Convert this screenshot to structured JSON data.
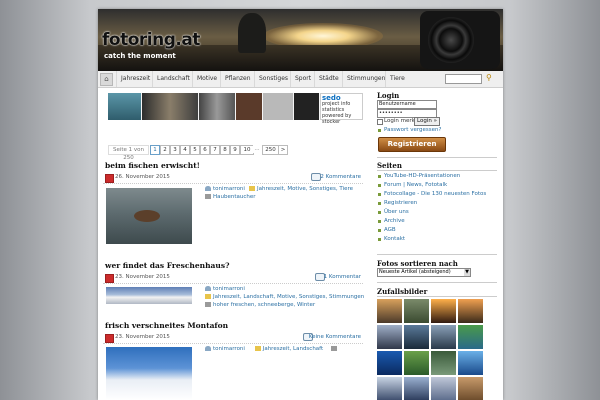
{
  "header": {
    "logo": "fotoring.at",
    "tagline": "catch the moment"
  },
  "nav": {
    "items": [
      "Jahreszeit",
      "Landschaft",
      "Motive",
      "Pflanzen",
      "Sonstiges",
      "Sport",
      "Städte",
      "Stimmungen",
      "Tiere"
    ]
  },
  "banner": {
    "sedo_title": "sedo",
    "sedo_line1": "project info",
    "sedo_line2": "statistics",
    "sedo_line3": "powered by stocker"
  },
  "pagination": {
    "info": "Seite 1 von 250",
    "pages": [
      "1",
      "2",
      "3",
      "4",
      "5",
      "6",
      "7",
      "8",
      "9",
      "10",
      "...",
      "250",
      ">"
    ]
  },
  "posts": [
    {
      "title": "beim fischen erwischt!",
      "date": "26. November 2015",
      "comments": "2 Kommentare",
      "author": "tonimarroni",
      "categories": "Jahreszeit, Motive, Sonstiges, Tiere",
      "tags": "Haubentaucher"
    },
    {
      "title": "wer findet das Freschenhaus?",
      "date": "23. November 2015",
      "comments": "1 Kommentar",
      "author": "tonimarroni",
      "categories": "Jahreszeit, Landschaft, Motive, Sonstiges, Stimmungen",
      "tags": "hoher freschen, schneeberge, Winter"
    },
    {
      "title": "frisch verschneites Montafon",
      "date": "23. November 2015",
      "comments": "Keine Kommentare",
      "author": "tonimarroni",
      "categories": "Jahreszeit, Landschaft",
      "tags": ""
    }
  ],
  "login": {
    "heading": "Login",
    "username_value": "Benutzername",
    "password_value": "••••••••",
    "remember_label": "Login merken",
    "login_button": "Login »",
    "forgot": "Passwort vergessen?",
    "register_button": "Registrieren"
  },
  "pages_widget": {
    "heading": "Seiten",
    "items": [
      "YouTube-HD-Präsentationen",
      "Forum | News, Fototalk",
      "Fotocollage - Die 130 neuesten Fotos",
      "Registrieren",
      "Über uns",
      "Archive",
      "AGB",
      "Kontakt"
    ]
  },
  "sort_widget": {
    "heading": "Fotos sortieren nach",
    "selected": "Neueste Artikel (absteigend)"
  },
  "random_widget": {
    "heading": "Zufallsbilder"
  },
  "colors": {
    "link": "#2a6fa3",
    "register_button": "#b46a25",
    "bullet": "#7a9b3a"
  }
}
